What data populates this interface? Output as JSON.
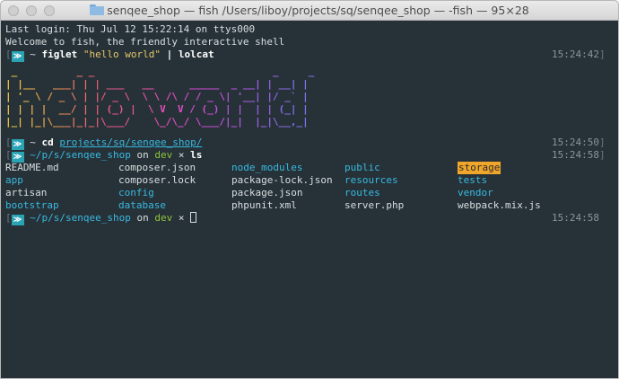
{
  "window": {
    "title": "senqee_shop — fish  /Users/liboy/projects/sq/senqee_shop — -fish — 95×28"
  },
  "terminal": {
    "login_line": "Last login: Thu Jul 12 15:22:14 on ttys000",
    "welcome_line": "Welcome to fish, the friendly interactive shell",
    "cmd1": {
      "prompt_symbol": "~",
      "command": "figlet",
      "arg": "\"hello world\"",
      "pipe": "|",
      "pipe_cmd": "lolcat",
      "timestamp": "15:24:42"
    },
    "figlet_art": [
      " _          _ _                              _     _ ",
      "| |__   ___| | | ___   __      _____  _ __| | __| |",
      "| '_ \\ / _ \\ | |/ _ \\  \\ \\ /\\ / / _ \\| '__| |/ _` |",
      "| | | |  __/ | | (_) |  \\ V  V / (_) | |  | | (_| |",
      "|_| |_|\\___|_|_|\\___/    \\_/\\_/ \\___/|_|  |_|\\__,_|"
    ],
    "cmd2": {
      "prompt_symbol": "~",
      "command": "cd",
      "arg": "projects/sq/senqee_shop/",
      "timestamp": "15:24:50"
    },
    "cmd3": {
      "path": "~/p/s/senqee_shop",
      "on": "on",
      "branch": "dev",
      "dirty": "×",
      "command": "ls",
      "timestamp": "15:24:58"
    },
    "ls_output": [
      [
        {
          "name": "README.md",
          "type": "file"
        },
        {
          "name": "composer.json",
          "type": "file"
        },
        {
          "name": "node_modules",
          "type": "dir"
        },
        {
          "name": "public",
          "type": "dir"
        },
        {
          "name": "storage",
          "type": "highlight"
        }
      ],
      [
        {
          "name": "app",
          "type": "dir"
        },
        {
          "name": "composer.lock",
          "type": "file"
        },
        {
          "name": "package-lock.json",
          "type": "file"
        },
        {
          "name": "resources",
          "type": "dir"
        },
        {
          "name": "tests",
          "type": "dir"
        }
      ],
      [
        {
          "name": "artisan",
          "type": "file"
        },
        {
          "name": "config",
          "type": "dir"
        },
        {
          "name": "package.json",
          "type": "file"
        },
        {
          "name": "routes",
          "type": "dir"
        },
        {
          "name": "vendor",
          "type": "dir"
        }
      ],
      [
        {
          "name": "bootstrap",
          "type": "dir"
        },
        {
          "name": "database",
          "type": "dir"
        },
        {
          "name": "phpunit.xml",
          "type": "file"
        },
        {
          "name": "server.php",
          "type": "file"
        },
        {
          "name": "webpack.mix.js",
          "type": "file"
        }
      ]
    ],
    "cmd4": {
      "path": "~/p/s/senqee_shop",
      "on": "on",
      "branch": "dev",
      "dirty": "×",
      "timestamp": "15:24:58"
    }
  },
  "colors": {
    "background": "#263238",
    "directory": "#3ab8e0",
    "branch": "#8fc33a",
    "string": "#e8c667",
    "highlight": "#f0a62b",
    "prompt_badge": "#2aa3b5"
  }
}
